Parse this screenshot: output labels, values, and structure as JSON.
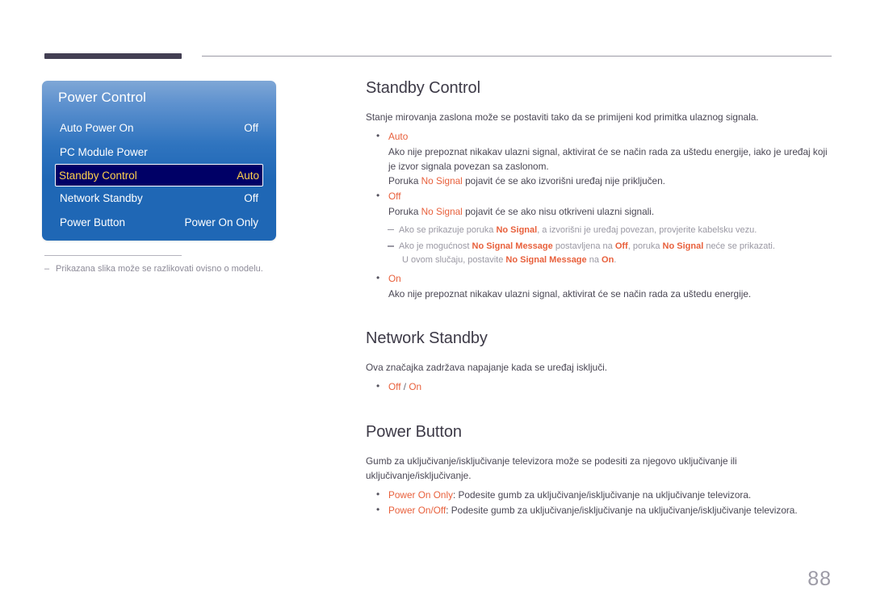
{
  "page": {
    "number": "88",
    "accent_color": "#e8603c",
    "heading_color": "#3d3a47",
    "osd_blue_top": "#7fa7d6",
    "osd_blue_bottom": "#1f67b5",
    "osd_selected_bg": "#000066",
    "osd_selected_text": "#ffd24d"
  },
  "osd": {
    "title": "Power Control",
    "rows": [
      {
        "label": "Auto Power On",
        "value": "Off",
        "selected": false
      },
      {
        "label": "PC Module Power",
        "value": "",
        "selected": false
      },
      {
        "label": "Standby Control",
        "value": "Auto",
        "selected": true
      },
      {
        "label": "Network Standby",
        "value": "Off",
        "selected": false
      },
      {
        "label": "Power Button",
        "value": "Power On Only",
        "selected": false
      }
    ]
  },
  "caption": {
    "dash": "–",
    "text": "Prikazana slika može se razlikovati ovisno o modelu."
  },
  "sections": {
    "standby_control": {
      "title": "Standby Control",
      "lead": "Stanje mirovanja zaslona može se postaviti tako da se primijeni kod primitka ulaznog signala.",
      "auto": {
        "term": "Auto",
        "line1": "Ako nije prepoznat nikakav ulazni signal, aktivirat će se način rada za uštedu energije, iako je uređaj koji je izvor signala povezan sa zaslonom.",
        "line2_pre": "Poruka ",
        "line2_hl": "No Signal",
        "line2_post": " pojavit će se ako izvorišni uređaj nije priključen."
      },
      "off": {
        "term": "Off",
        "line1_pre": "Poruka ",
        "line1_hl": "No Signal",
        "line1_post": " pojavit će se ako nisu otkriveni ulazni signali."
      },
      "notes": [
        {
          "pre": "Ako se prikazuje poruka ",
          "hl1": "No Signal",
          "post": ", a izvorišni je uređaj povezan, provjerite kabelsku vezu."
        }
      ],
      "note2": {
        "p1": "Ako je mogućnost ",
        "hl1": "No Signal Message",
        "p2": " postavljena na ",
        "hl2": "Off",
        "p3": ", poruka ",
        "hl3": "No Signal",
        "p4": " neće se prikazati.",
        "c1": "U ovom slučaju, postavite ",
        "hl4": "No Signal Message",
        "c2": " na ",
        "hl5": "On",
        "c3": "."
      },
      "on": {
        "term": "On",
        "line1": "Ako nije prepoznat nikakav ulazni signal, aktivirat će se način rada za uštedu energije."
      }
    },
    "network_standby": {
      "title": "Network Standby",
      "lead": "Ova značajka zadržava napajanje kada se uređaj isključi.",
      "option_off": "Off",
      "option_sep": " / ",
      "option_on": "On"
    },
    "power_button": {
      "title": "Power Button",
      "lead": "Gumb za uključivanje/isključivanje televizora može se podesiti za njegovo uključivanje ili uključivanje/isključivanje.",
      "items": [
        {
          "term": "Power On Only",
          "rest": ": Podesite gumb za uključivanje/isključivanje na uključivanje televizora."
        },
        {
          "term": "Power On/Off",
          "rest": ": Podesite gumb za uključivanje/isključivanje na uključivanje/isključivanje televizora."
        }
      ]
    }
  }
}
